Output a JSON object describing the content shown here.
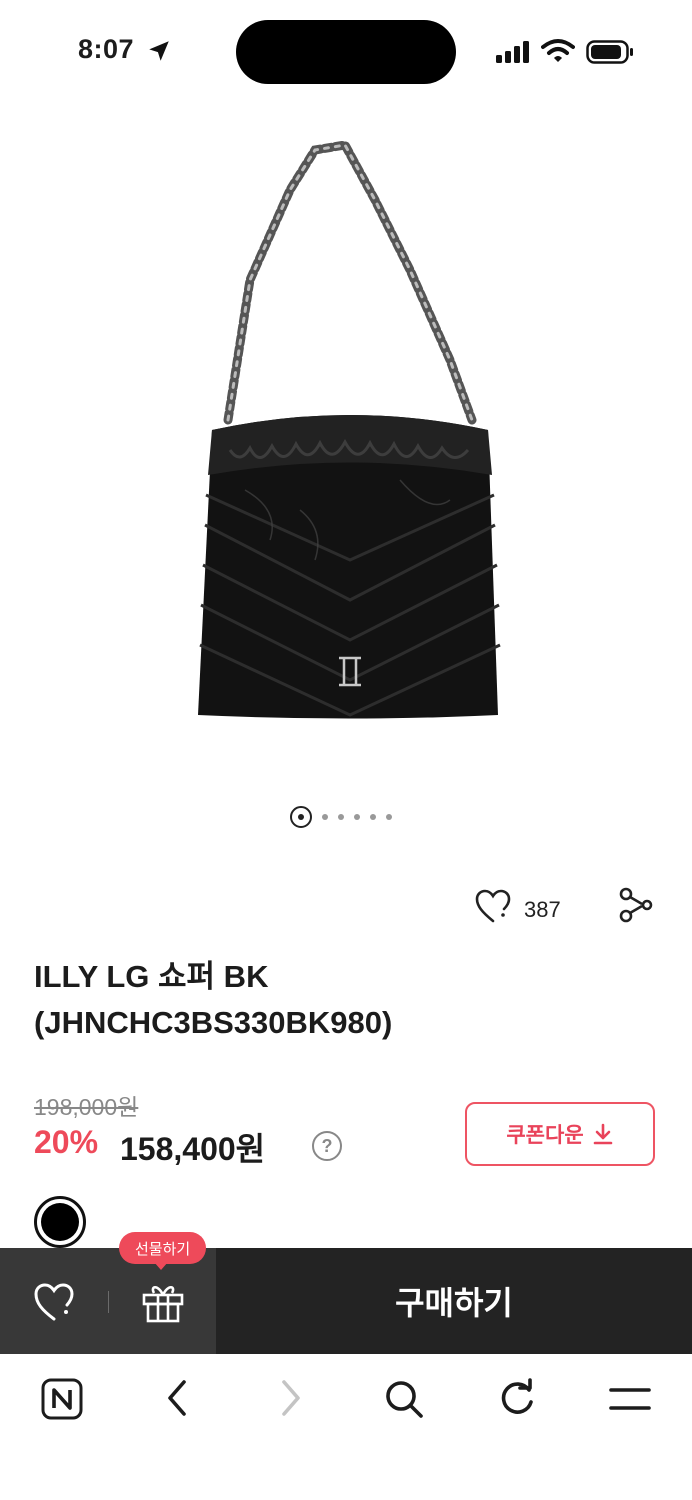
{
  "status_bar": {
    "time": "8:07"
  },
  "product": {
    "image_alt": "black quilted leather chain shopper bag",
    "title_line1": "ILLY LG 쇼퍼 BK",
    "title_line2": "(JHNCHC3BS330BK980)",
    "original_price": "198,000원",
    "discount": "20%",
    "price": "158,400원",
    "like_count": "387",
    "color_option": "black"
  },
  "pager": {
    "total": 6,
    "active": 1
  },
  "actions": {
    "coupon_label": "쿠폰다운",
    "gift_tooltip": "선물하기",
    "buy_label": "구매하기",
    "help_symbol": "?"
  },
  "icons": {
    "like": "heart-icon",
    "share": "share-icon",
    "download": "download-icon",
    "gift": "gift-icon",
    "nav": [
      "naver-home-icon",
      "back-icon",
      "forward-icon",
      "search-icon",
      "refresh-icon",
      "menu-icon"
    ]
  },
  "colors": {
    "accent": "#ee4a5a",
    "dark_bar": "#232323",
    "dark_bar_left": "#383838"
  }
}
